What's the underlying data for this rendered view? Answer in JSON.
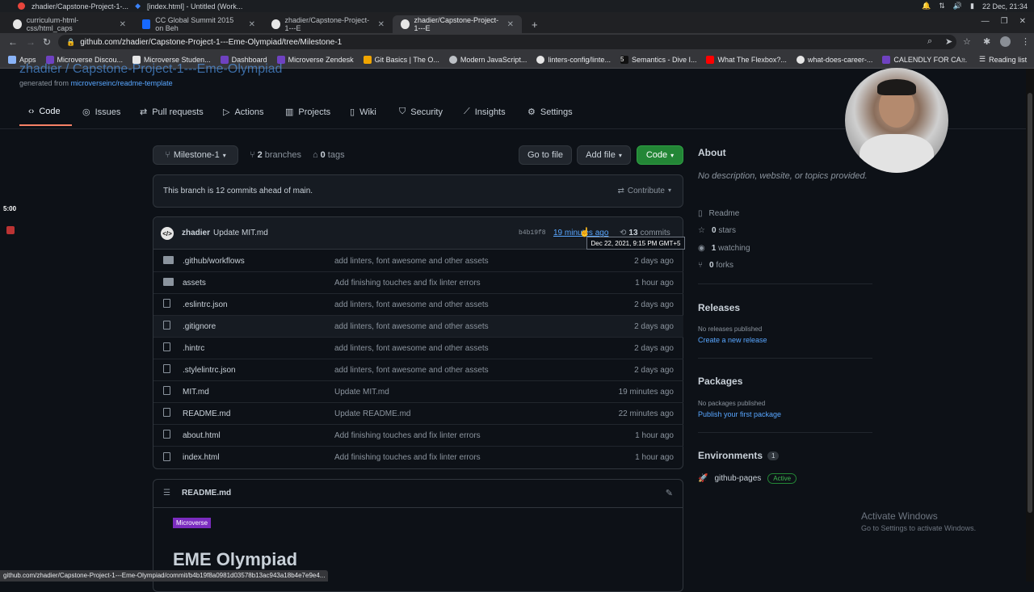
{
  "os": {
    "tasks": [
      "zhadier/Capstone-Project-1-...",
      "[index.html] - Untitled (Work..."
    ],
    "clock": "22 Dec, 21:34"
  },
  "tabs": [
    {
      "label": "curriculum-html-css/html_caps",
      "icon": "github-icon"
    },
    {
      "label": "CC Global Summit 2015 on Beh",
      "icon": "behance-icon"
    },
    {
      "label": "zhadier/Capstone-Project-1---E",
      "icon": "github-icon"
    },
    {
      "label": "zhadier/Capstone-Project-1---E",
      "icon": "github-icon"
    }
  ],
  "address": {
    "url": "github.com/zhadier/Capstone-Project-1---Eme-Olympiad/tree/Milestone-1"
  },
  "bookmarks": [
    {
      "label": "Apps",
      "color": "#8ab4f8"
    },
    {
      "label": "Microverse Discou...",
      "color": "#6f42c1"
    },
    {
      "label": "Microverse Studen...",
      "color": "#2b2b2b"
    },
    {
      "label": "Dashboard",
      "color": "#6f42c1"
    },
    {
      "label": "Microverse Zendesk",
      "color": "#6f42c1"
    },
    {
      "label": "Git Basics | The O...",
      "color": "#f0a500"
    },
    {
      "label": "Modern JavaScript...",
      "color": "#333333"
    },
    {
      "label": "linters-config/linte...",
      "color": "#e6e6e6"
    },
    {
      "label": "Semantics - Dive I...",
      "color": "#111111"
    },
    {
      "label": "What The Flexbox?...",
      "color": "#ff0000"
    },
    {
      "label": "what-does-career-...",
      "color": "#e6e6e6"
    },
    {
      "label": "CALENDLY FOR CA...",
      "color": "#6f42c1"
    }
  ],
  "reading_list": "Reading list",
  "repo": {
    "title": "zhadier / Capstone-Project-1---Eme-Olympiad",
    "generated_prefix": "generated from",
    "generated_link": "microverseinc/readme-template"
  },
  "repo_tabs": [
    "Code",
    "Issues",
    "Pull requests",
    "Actions",
    "Projects",
    "Wiki",
    "Security",
    "Insights",
    "Settings"
  ],
  "toolbar": {
    "branch": "Milestone-1",
    "branches_count": "2",
    "branches_label": "branches",
    "tags_count": "0",
    "tags_label": "tags",
    "goto_file": "Go to file",
    "add_file": "Add file",
    "code": "Code"
  },
  "branch_status": {
    "text": "This branch is 12 commits ahead of main.",
    "contribute": "Contribute"
  },
  "commit": {
    "author": "zhadier",
    "message": "Update MIT.md",
    "sha": "b4b19f8",
    "time": "19 minutes ago",
    "commits_count": "13",
    "commits_label": "commits",
    "tooltip": "Dec 22, 2021, 9:15 PM GMT+5"
  },
  "files": [
    {
      "type": "folder",
      "name": ".github/workflows",
      "message": "add linters, font awesome and other assets",
      "time": "2 days ago"
    },
    {
      "type": "folder",
      "name": "assets",
      "message": "Add finishing touches and fix linter errors",
      "time": "1 hour ago"
    },
    {
      "type": "file",
      "name": ".eslintrc.json",
      "message": "add linters, font awesome and other assets",
      "time": "2 days ago"
    },
    {
      "type": "file",
      "name": ".gitignore",
      "message": "add linters, font awesome and other assets",
      "time": "2 days ago"
    },
    {
      "type": "file",
      "name": ".hintrc",
      "message": "add linters, font awesome and other assets",
      "time": "2 days ago"
    },
    {
      "type": "file",
      "name": ".stylelintrc.json",
      "message": "add linters, font awesome and other assets",
      "time": "2 days ago"
    },
    {
      "type": "file",
      "name": "MIT.md",
      "message": "Update MIT.md",
      "time": "19 minutes ago"
    },
    {
      "type": "file",
      "name": "README.md",
      "message": "Update README.md",
      "time": "22 minutes ago"
    },
    {
      "type": "file",
      "name": "about.html",
      "message": "Add finishing touches and fix linter errors",
      "time": "1 hour ago"
    },
    {
      "type": "file",
      "name": "index.html",
      "message": "Add finishing touches and fix linter errors",
      "time": "1 hour ago"
    }
  ],
  "readme": {
    "filename": "README.md",
    "logo_text": "Microverse",
    "heading": "EME Olympiad"
  },
  "about": {
    "heading": "About",
    "description": "No description, website, or topics provided.",
    "readme": "Readme",
    "stars_count": "0",
    "stars_label": "stars",
    "watching_count": "1",
    "watching_label": "watching",
    "forks_count": "0",
    "forks_label": "forks"
  },
  "releases": {
    "heading": "Releases",
    "none": "No releases published",
    "link": "Create a new release"
  },
  "packages": {
    "heading": "Packages",
    "none": "No packages published",
    "link": "Publish your first package"
  },
  "environments": {
    "heading": "Environments",
    "count": "1",
    "name": "github-pages",
    "status": "Active"
  },
  "watermark": {
    "line1": "Activate Windows",
    "line2": "Go to Settings to activate Windows."
  },
  "status_url": "github.com/zhadier/Capstone-Project-1---Eme-Olympiad/commit/b4b19f8a0981d03578b13ac943a18b4e7e9e4...",
  "timer": "5:00"
}
